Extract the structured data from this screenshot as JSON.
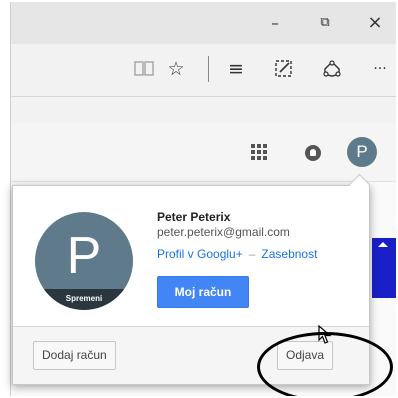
{
  "window": {
    "minimize_glyph": "–",
    "restore_glyph": "⧉",
    "close_glyph": "×"
  },
  "toolbar": {
    "icons": [
      "reading-view-icon",
      "favorites-star-icon",
      "hub-icon",
      "web-note-icon",
      "share-icon",
      "more-icon"
    ],
    "star_glyph": "☆",
    "hub_glyph": "≡",
    "more_glyph": "···"
  },
  "header": {
    "avatar_letter": "P"
  },
  "account_popup": {
    "avatar_letter": "P",
    "change_photo_label": "Spremeni",
    "name": "Peter Peterix",
    "email": "peter.peterix@gmail.com",
    "profile_link": "Profil v Googlu+",
    "separator": "–",
    "privacy_link": "Zasebnost",
    "my_account_button": "Moj račun",
    "add_account_button": "Dodaj račun",
    "sign_out_button": "Odjava"
  },
  "colors": {
    "avatar_bg": "#5e7a8b",
    "primary_button": "#4285f4",
    "link": "#1a73e8"
  }
}
